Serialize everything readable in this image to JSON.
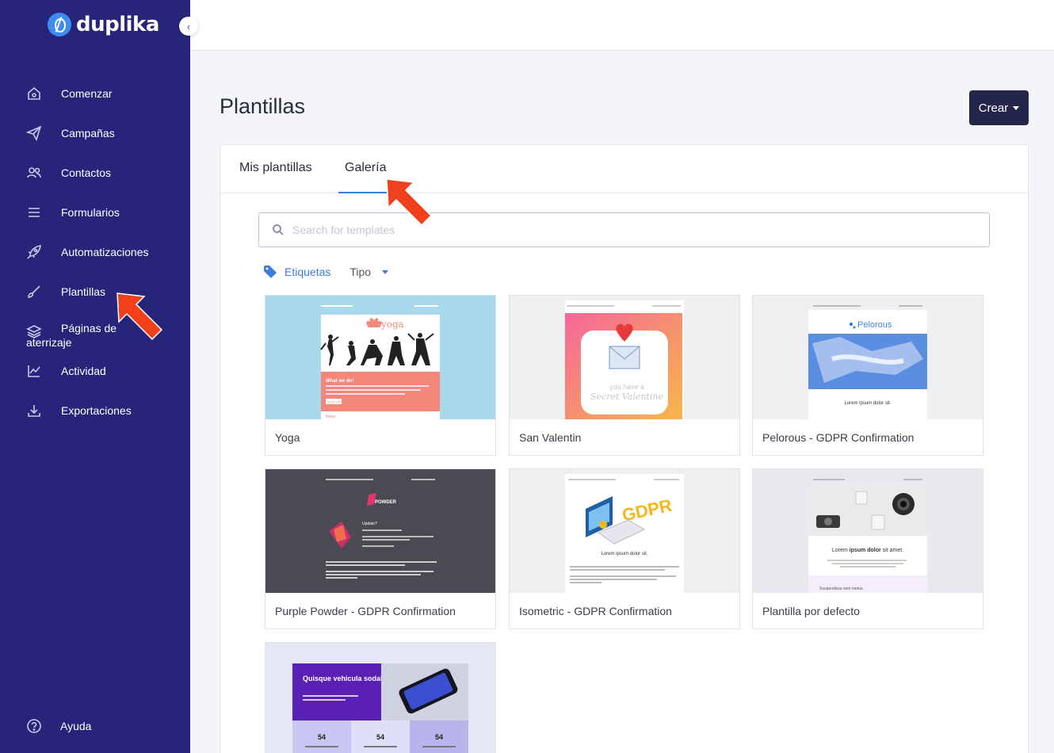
{
  "brand": {
    "name": "duplika"
  },
  "sidebar": {
    "items": [
      {
        "label": "Comenzar",
        "icon": "home-icon"
      },
      {
        "label": "Campañas",
        "icon": "paper-plane-icon"
      },
      {
        "label": "Contactos",
        "icon": "users-icon"
      },
      {
        "label": "Formularios",
        "icon": "menu-lines-icon"
      },
      {
        "label": "Automatizaciones",
        "icon": "rocket-icon"
      },
      {
        "label": "Plantillas",
        "icon": "brush-icon"
      },
      {
        "label": "Páginas de",
        "label2": "aterrizaje",
        "icon": "layers-icon"
      },
      {
        "label": "Actividad",
        "icon": "chart-line-icon"
      },
      {
        "label": "Exportaciones",
        "icon": "download-icon"
      }
    ],
    "help": {
      "label": "Ayuda",
      "icon": "question-circle-icon"
    }
  },
  "header": {
    "title": "Plantillas",
    "create_label": "Crear"
  },
  "tabs": [
    {
      "label": "Mis plantillas",
      "active": false
    },
    {
      "label": "Galería",
      "active": true
    }
  ],
  "search": {
    "placeholder": "Search for templates"
  },
  "filters": {
    "tags_label": "Etiquetas",
    "type_label": "Tipo"
  },
  "templates": [
    {
      "name": "Yoga"
    },
    {
      "name": "San Valentin"
    },
    {
      "name": "Pelorous - GDPR Confirmation"
    },
    {
      "name": "Purple Powder - GDPR Confirmation"
    },
    {
      "name": "Isometric - GDPR Confirmation"
    },
    {
      "name": "Plantilla por defecto"
    },
    {
      "name": ""
    }
  ],
  "thumb_text": {
    "yoga_brand": "yoga",
    "yoga_heading": "What we do!",
    "yoga_button": "SIGN UP",
    "yoga_news": "News",
    "valentine_line1": "you have a",
    "valentine_line2": "Secret Valentine",
    "pelorous_brand": "Pelorous",
    "pelorous_caption": "Lorem ipsum dolor sit.",
    "powder_brand": "POWDER",
    "powder_heading": "Update?",
    "gdpr_text": "GDPR",
    "isometric_caption": "Lorem ipsum dolor sit.",
    "default_caption_1": "Lorem ",
    "default_caption_bold": "ipsum dolor",
    "default_caption_2": " sit amet.",
    "default_sub": "Suspendisse sem metus.",
    "promo_heading": "Quisque vehicula sodales",
    "promo_stat_1": "54",
    "promo_stat_2": "54",
    "promo_stat_3": "54"
  },
  "colors": {
    "sidebar": "#27257a",
    "accent": "#3d7bdc",
    "create_button": "#23264a",
    "annotation_arrow": "#f1401c"
  }
}
